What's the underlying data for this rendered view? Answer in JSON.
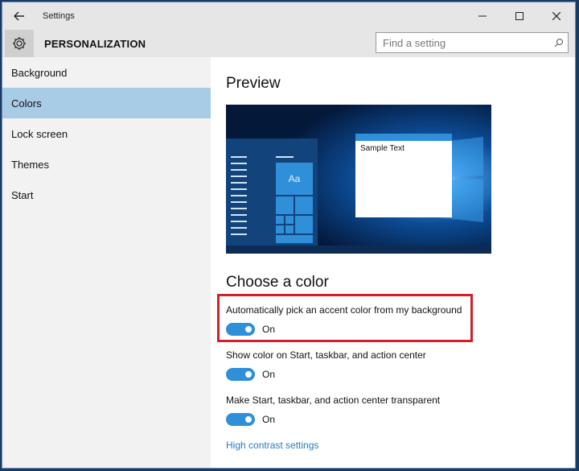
{
  "window": {
    "title": "Settings",
    "section": "PERSONALIZATION"
  },
  "search": {
    "placeholder": "Find a setting"
  },
  "icons": {
    "back": "back-arrow-icon",
    "gear": "gear-icon",
    "search": "search-icon",
    "minimize": "minimize-icon",
    "maximize": "maximize-icon",
    "close": "close-icon"
  },
  "sidebar": {
    "items": [
      {
        "label": "Background"
      },
      {
        "label": "Colors"
      },
      {
        "label": "Lock screen"
      },
      {
        "label": "Themes"
      },
      {
        "label": "Start"
      }
    ],
    "active": "Colors"
  },
  "main": {
    "preview_heading": "Preview",
    "sample_text": "Sample Text",
    "tile_text": "Aa",
    "choose_heading": "Choose a color",
    "settings": [
      {
        "label": "Automatically pick an accent color from my background",
        "state": "On"
      },
      {
        "label": "Show color on Start, taskbar, and action center",
        "state": "On"
      },
      {
        "label": "Make Start, taskbar, and action center transparent",
        "state": "On"
      }
    ],
    "link": "High contrast settings"
  },
  "colors": {
    "accent": "#2f8fd8",
    "highlight_border": "#d0202a",
    "selected_nav": "#a8cbe6",
    "link": "#2a7cbf"
  }
}
